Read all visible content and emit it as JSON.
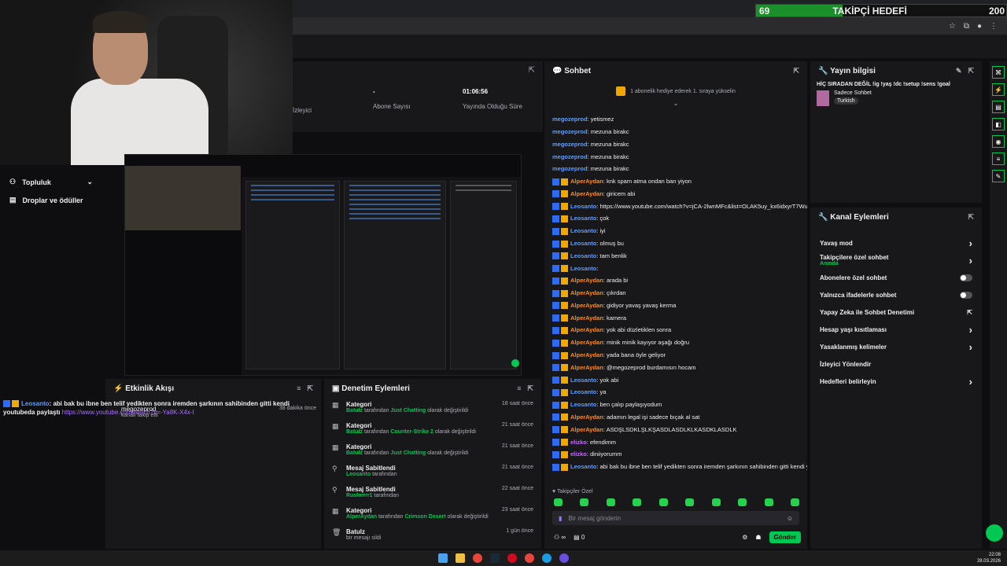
{
  "follow_goal": {
    "current": "69",
    "label": "TAKİPÇİ HEDEFİ",
    "target": "200"
  },
  "browser": {
    "icons": [
      "star-icon",
      "puzzle-icon",
      "profile-icon",
      "menu-icon"
    ]
  },
  "sidebar": {
    "items": [
      {
        "label": "Topluluk",
        "icon": "people-icon"
      },
      {
        "label": "Droplar ve ödüller",
        "icon": "gift-icon"
      }
    ]
  },
  "stats": {
    "viewers_label": "İzleyici",
    "subs_value": "-",
    "subs_label": "Abone Sayısı",
    "uptime_value": "01:06:56",
    "uptime_label": "Yayında Olduğu Süre"
  },
  "activity": {
    "title": "Etkinlik Akışı",
    "message_user": "Leosanto",
    "message_text": ": abi bak bu ibne ben telif yedikten sonra iremden şarkının sahibinden gitti kendi youtubeda paylaştı",
    "message_link": "https://www.youtube.com/watch?v=-Ya8K-X4x-I",
    "event_user": "megozeprod",
    "event_text": "kanalı takip etti",
    "event_time": "38 dakika önce"
  },
  "moderation": {
    "title": "Denetim Eylemleri",
    "rows": [
      {
        "title": "Kategori",
        "user": "Batulz",
        "mid": " tarafından ",
        "value": "Just Chatting",
        "suffix": " olarak değiştirildi",
        "time": "18 saat önce",
        "icon": "category-icon"
      },
      {
        "title": "Kategori",
        "user": "Batulz",
        "mid": " tarafından ",
        "value": "Counter-Strike 2",
        "suffix": " olarak değiştirildi",
        "time": "21 saat önce",
        "icon": "category-icon"
      },
      {
        "title": "Kategori",
        "user": "Batulz",
        "mid": " tarafından ",
        "value": "Just Chatting",
        "suffix": " olarak değiştirildi",
        "time": "21 saat önce",
        "icon": "category-icon"
      },
      {
        "title": "Mesaj Sabitlendi",
        "user": "Leosanto",
        "mid": " tarafından",
        "value": "",
        "suffix": "",
        "time": "21 saat önce",
        "icon": "pin-icon"
      },
      {
        "title": "Mesaj Sabitlendi",
        "user": "Rusherrr1",
        "mid": " tarafından",
        "value": "",
        "suffix": "",
        "time": "22 saat önce",
        "icon": "pin-icon"
      },
      {
        "title": "Kategori",
        "user": "AlperAydan",
        "mid": " tarafından ",
        "value": "Crimson Desert",
        "suffix": " olarak değiştirildi",
        "time": "23 saat önce",
        "icon": "category-icon"
      },
      {
        "title": "Batulz",
        "user": "",
        "mid": "bir mesajı sildi",
        "value": "",
        "suffix": "",
        "time": "1 gün önce",
        "icon": "trash-icon"
      }
    ]
  },
  "chat": {
    "title": "Sohbet",
    "gift_banner": "1 abonelik hediye ederek 1. sıraya yükselin",
    "messages": [
      {
        "user": "megozeprod",
        "color": "#5c9dff",
        "text": ": yetismez",
        "badge": false
      },
      {
        "user": "megozeprod",
        "color": "#5c9dff",
        "text": ": mezuna birakc",
        "badge": false
      },
      {
        "user": "megozeprod",
        "color": "#5c9dff",
        "text": ": mezuna birakc",
        "badge": false
      },
      {
        "user": "megozeprod",
        "color": "#5c9dff",
        "text": ": mezuna birakc",
        "badge": false
      },
      {
        "user": "megozeprod",
        "color": "#5c9dff",
        "text": ": mezuna birakc",
        "badge": false
      },
      {
        "user": "AlperAydan",
        "color": "#ff8c1a",
        "text": ": knk spam atma ondan ban yiyon",
        "badge": true
      },
      {
        "user": "AlperAydan",
        "color": "#ff8c1a",
        "text": ": giricem abi",
        "badge": true
      },
      {
        "user": "Leosanto",
        "color": "#5c9dff",
        "text": ": https://www.youtube.com/watch?v=jCA-2lwnMFc&list=OLAK5uy_kx6idxyrT7WudQnQUlpMnRlXGL8TvWmmA",
        "badge": true
      },
      {
        "user": "Leosanto",
        "color": "#5c9dff",
        "text": ": çok",
        "badge": true
      },
      {
        "user": "Leosanto",
        "color": "#5c9dff",
        "text": ": iyi",
        "badge": true
      },
      {
        "user": "Leosanto",
        "color": "#5c9dff",
        "text": ": olmuş bu",
        "badge": true
      },
      {
        "user": "Leosanto",
        "color": "#5c9dff",
        "text": ": tam benlik",
        "badge": true
      },
      {
        "user": "Leosanto",
        "color": "#5c9dff",
        "text": ":",
        "badge": true
      },
      {
        "user": "AlperAydan",
        "color": "#ff8c1a",
        "text": ": arada bi",
        "badge": true
      },
      {
        "user": "AlperAydan",
        "color": "#ff8c1a",
        "text": ": çıkrdan",
        "badge": true
      },
      {
        "user": "AlperAydan",
        "color": "#ff8c1a",
        "text": ": gidiyor yavaş yavaş kerma",
        "badge": true
      },
      {
        "user": "AlperAydan",
        "color": "#ff8c1a",
        "text": ": kamera",
        "badge": true
      },
      {
        "user": "AlperAydan",
        "color": "#ff8c1a",
        "text": ": yok abi düzletiklen sonra",
        "badge": true
      },
      {
        "user": "AlperAydan",
        "color": "#ff8c1a",
        "text": ": minik minik kayıyor aşağı doğru",
        "badge": true
      },
      {
        "user": "AlperAydan",
        "color": "#ff8c1a",
        "text": ": yada bana öyle geliyor",
        "badge": true
      },
      {
        "user": "AlperAydan",
        "color": "#ff8c1a",
        "text": ": @megozeprod burdamısın hocam",
        "badge": true
      },
      {
        "user": "Leosanto",
        "color": "#5c9dff",
        "text": ": yok abi",
        "badge": true
      },
      {
        "user": "Leosanto",
        "color": "#5c9dff",
        "text": ": ya",
        "badge": true
      },
      {
        "user": "Leosanto",
        "color": "#5c9dff",
        "text": ": ben çalıp paylaşıyodum",
        "badge": true
      },
      {
        "user": "AlperAydan",
        "color": "#ff8c1a",
        "text": ": adamın legal işi sadece bıçak al sat",
        "badge": true
      },
      {
        "user": "AlperAydan",
        "color": "#ff8c1a",
        "text": ": ASDŞLSDKLŞLKŞASDLASDLKLKASDKLASDLK",
        "badge": true
      },
      {
        "user": "elizko",
        "color": "#c46bff",
        "text": ": efendimm",
        "badge": true
      },
      {
        "user": "elizko",
        "color": "#c46bff",
        "text": ": diniiyorumm",
        "badge": true
      },
      {
        "user": "Leosanto",
        "color": "#5c9dff",
        "text": ": abi bak bu ibne ben telif yedikten sonra iremden şarkının sahibinden gitti kendi youtubeda paylaştı https://www.youtube.com/watch?v=-Ya8K-X4x-I",
        "badge": true
      }
    ],
    "followers_only": "Takipçiler Özel",
    "input_placeholder": "Bir mesaj gönderin",
    "viewers": "∞",
    "gifts": "0",
    "send": "Gönder"
  },
  "stream_info": {
    "title": "Yayın bilgisi",
    "stream_title": "HİÇ SIRADAN DEĞİL !ig !yaş !dc !setup !sens !goal",
    "category": "Sadece Sohbet",
    "tag": "Turkish"
  },
  "channel_actions": {
    "title": "Kanal Eylemleri",
    "items": [
      {
        "label": "Yavaş mod",
        "sub": "",
        "control": "chevron"
      },
      {
        "label": "Takipçilere özel sohbet",
        "sub": "Anında",
        "control": "chevron"
      },
      {
        "label": "Abonelere özel sohbet",
        "sub": "",
        "control": "toggle"
      },
      {
        "label": "Yalnızca ifadelerle sohbet",
        "sub": "",
        "control": "toggle"
      },
      {
        "label": "Yapay Zeka ile Sohbet Denetimi",
        "sub": "",
        "control": "external"
      },
      {
        "label": "Hesap yaşı kısıtlaması",
        "sub": "",
        "control": "chevron"
      },
      {
        "label": "Yasaklanmış kelimeler",
        "sub": "",
        "control": "chevron"
      },
      {
        "label": "İzleyici Yönlendir",
        "sub": "",
        "control": "none"
      },
      {
        "label": "Hedefleri belirleyin",
        "sub": "",
        "control": "chevron"
      }
    ]
  },
  "taskbar": {
    "time": "22:08",
    "date": "28.03.2026"
  },
  "colors": {
    "accent": "#00c853",
    "bg": "#0e0e10",
    "panel": "#18181b"
  }
}
